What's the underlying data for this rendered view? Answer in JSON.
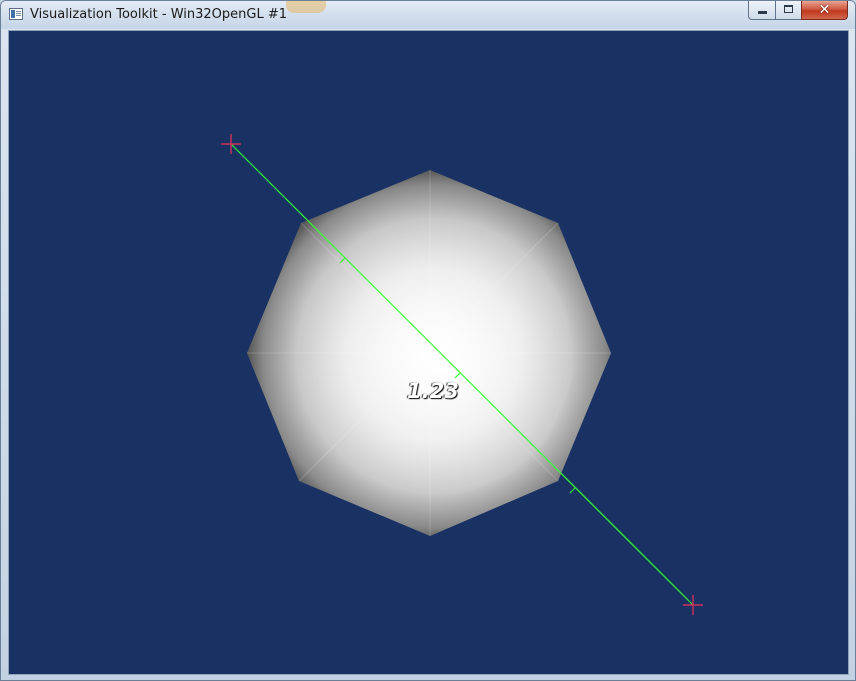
{
  "window": {
    "title": "Visualization Toolkit - Win32OpenGL #1",
    "close_glyph": "✕",
    "app_icon": "vtk-window-icon"
  },
  "viewport": {
    "background_color": "#1a3263",
    "widget_line_color": "#33ff33",
    "handle_color": "#d0305a",
    "distance_label": "1.23",
    "shape": "octagon (shaded sphere tessellation)"
  }
}
